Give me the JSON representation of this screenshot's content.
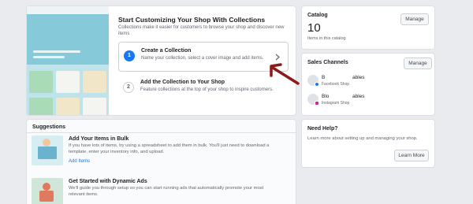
{
  "collections": {
    "title": "Start Customizing Your Shop With Collections",
    "desc_line1": "Collections make it easier for customers to browse your shop and discover new",
    "desc_line2": "items",
    "step1": {
      "num": "1",
      "title": "Create a Collection",
      "desc": "Name your collection, select a cover image and add items."
    },
    "step2": {
      "num": "2",
      "title": "Add the Collection to Your Shop",
      "desc": "Feature collections at the top of your shop to inspire customers."
    }
  },
  "catalog": {
    "title": "Catalog",
    "count": "10",
    "count_label": "Items in this catalog",
    "manage_label": "Manage"
  },
  "sales_channels": {
    "title": "Sales Channels",
    "manage_label": "Manage",
    "channels": [
      {
        "name_start": "B",
        "name_end": "ables",
        "sub": "Facebook Shop"
      },
      {
        "name_start": "Blo",
        "name_end": "ables",
        "sub": "Instagram Shop"
      }
    ]
  },
  "suggestions": {
    "title": "Suggestions",
    "items": [
      {
        "title": "Add Your Items in Bulk",
        "desc_line1": "If you have lots of items, try using a spreadsheet to add them in bulk. You'll just need to download a",
        "desc_line2": "template, enter your inventory info, and upload.",
        "link": "Add Items"
      },
      {
        "title": "Get Started with Dynamic Ads",
        "desc_line1": "We'll guide you through setup so you can start running ads that automatically promote your most",
        "desc_line2": "relevant items."
      }
    ]
  },
  "help": {
    "title": "Need Help?",
    "desc": "Learn more about setting up and managing your shop.",
    "button_label": "Learn More"
  },
  "colors": {
    "accent": "#1877f2",
    "annotation": "#8b1a1a"
  },
  "icons": [
    "chevron-right-icon",
    "facebook-icon",
    "instagram-icon",
    "arrow-annotation-icon"
  ]
}
